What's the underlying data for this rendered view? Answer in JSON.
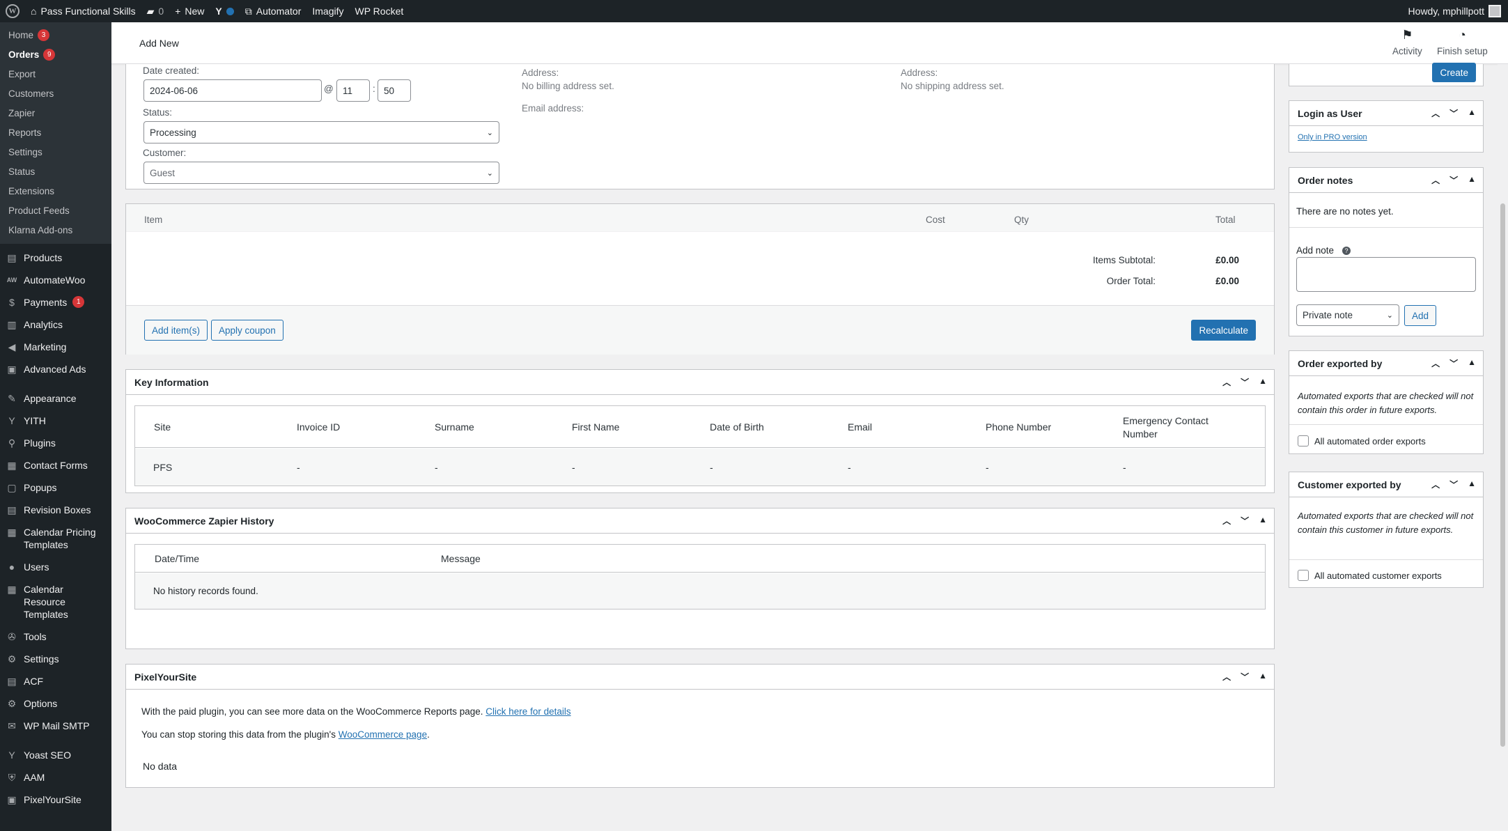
{
  "admin_bar": {
    "site_name": "Pass Functional Skills",
    "comments_count": "0",
    "new_label": "New",
    "automator": "Automator",
    "imagify": "Imagify",
    "wp_rocket": "WP Rocket",
    "howdy": "Howdy, mphillpott"
  },
  "sidebar": {
    "submenu": [
      {
        "label": "Home",
        "badge": "3"
      },
      {
        "label": "Orders",
        "badge": "9"
      },
      {
        "label": "Export"
      },
      {
        "label": "Customers"
      },
      {
        "label": "Zapier"
      },
      {
        "label": "Reports"
      },
      {
        "label": "Settings"
      },
      {
        "label": "Status"
      },
      {
        "label": "Extensions"
      },
      {
        "label": "Product Feeds"
      },
      {
        "label": "Klarna Add-ons"
      }
    ],
    "menu": [
      {
        "label": "Products",
        "icon": "products-icon"
      },
      {
        "label": "AutomateWoo",
        "icon": "automatewoo-icon"
      },
      {
        "label": "Payments",
        "icon": "payments-icon",
        "badge": "1"
      },
      {
        "label": "Analytics",
        "icon": "analytics-icon"
      },
      {
        "label": "Marketing",
        "icon": "marketing-icon"
      },
      {
        "label": "Advanced Ads",
        "icon": "advanced-ads-icon"
      },
      {
        "label": "Appearance",
        "icon": "appearance-icon"
      },
      {
        "label": "YITH",
        "icon": "yith-icon"
      },
      {
        "label": "Plugins",
        "icon": "plugins-icon"
      },
      {
        "label": "Contact Forms",
        "icon": "contact-forms-icon"
      },
      {
        "label": "Popups",
        "icon": "popups-icon"
      },
      {
        "label": "Revision Boxes",
        "icon": "revision-boxes-icon"
      },
      {
        "label": "Calendar Pricing Templates",
        "icon": "calendar-icon"
      },
      {
        "label": "Users",
        "icon": "users-icon"
      },
      {
        "label": "Calendar Resource Templates",
        "icon": "calendar-icon"
      },
      {
        "label": "Tools",
        "icon": "tools-icon"
      },
      {
        "label": "Settings",
        "icon": "settings-icon"
      },
      {
        "label": "ACF",
        "icon": "acf-icon"
      },
      {
        "label": "Options",
        "icon": "options-icon"
      },
      {
        "label": "WP Mail SMTP",
        "icon": "mail-icon"
      },
      {
        "label": "Yoast SEO",
        "icon": "yoast-icon"
      },
      {
        "label": "AAM",
        "icon": "aam-icon"
      },
      {
        "label": "PixelYourSite",
        "icon": "pixelyoursite-icon"
      }
    ]
  },
  "topbar": {
    "title": "Add New",
    "activity": "Activity",
    "finish_setup": "Finish setup"
  },
  "order": {
    "date_created_label": "Date created:",
    "date": "2024-06-06",
    "at": "@",
    "hour": "11",
    "colon": ":",
    "minute": "50",
    "status_label": "Status:",
    "status": "Processing",
    "customer_label": "Customer:",
    "customer": "Guest",
    "billing_address_label": "Address:",
    "billing_address": "No billing address set.",
    "email_label": "Email address:",
    "shipping_address_label": "Address:",
    "shipping_address": "No shipping address set."
  },
  "items": {
    "headers": {
      "item": "Item",
      "cost": "Cost",
      "qty": "Qty",
      "total": "Total"
    },
    "subtotal_label": "Items Subtotal:",
    "subtotal": "£0.00",
    "total_label": "Order Total:",
    "total": "£0.00",
    "add_items": "Add item(s)",
    "apply_coupon": "Apply coupon",
    "recalculate": "Recalculate"
  },
  "key_info": {
    "title": "Key Information",
    "headers": [
      "Site",
      "Invoice ID",
      "Surname",
      "First Name",
      "Date of Birth",
      "Email",
      "Phone Number",
      "Emergency Contact Number"
    ],
    "row": [
      "PFS",
      "-",
      "-",
      "-",
      "-",
      "-",
      "-",
      "-"
    ]
  },
  "zapier": {
    "title": "WooCommerce Zapier History",
    "headers": [
      "Date/Time",
      "Message"
    ],
    "empty": "No history records found."
  },
  "pixel": {
    "title": "PixelYourSite",
    "line1": "With the paid plugin, you can see more data on the WooCommerce Reports page.",
    "line1_link": "Click here for details",
    "line2": "You can stop storing this data from the plugin's",
    "line2_link": "WooCommerce page",
    "line2_end": ".",
    "no_data": "No data"
  },
  "right": {
    "create": "Create",
    "login_as_user": {
      "title": "Login as User",
      "link": "Only in PRO version"
    },
    "order_notes": {
      "title": "Order notes",
      "empty": "There are no notes yet.",
      "add_note_label": "Add note",
      "note_type": "Private note",
      "add": "Add"
    },
    "order_exported_by": {
      "title": "Order exported by",
      "desc": "Automated exports that are checked will not contain this order in future exports.",
      "checkbox": "All automated order exports"
    },
    "customer_exported_by": {
      "title": "Customer exported by",
      "desc": "Automated exports that are checked will not contain this customer in future exports.",
      "checkbox": "All automated customer exports"
    }
  },
  "colors": {
    "admin_dark": "#1d2327",
    "accent": "#2271b1",
    "badge": "#d63638"
  }
}
